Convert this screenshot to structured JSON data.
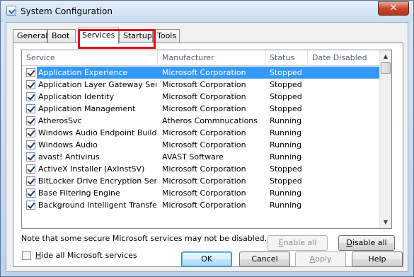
{
  "window": {
    "title": "System Configuration",
    "close_glyph": "✕"
  },
  "tabs": [
    {
      "label": "General"
    },
    {
      "label": "Boot"
    },
    {
      "label": "Services",
      "active": true
    },
    {
      "label": "Startup"
    },
    {
      "label": "Tools"
    }
  ],
  "services_list": {
    "columns": [
      "Service",
      "Manufacturer",
      "Status",
      "Date Disabled"
    ],
    "rows": [
      {
        "name": "Application Experience",
        "manufacturer": "Microsoft Corporation",
        "status": "Stopped",
        "checked": true,
        "selected": true
      },
      {
        "name": "Application Layer Gateway Service",
        "manufacturer": "Microsoft Corporation",
        "status": "Stopped",
        "checked": true
      },
      {
        "name": "Application Identity",
        "manufacturer": "Microsoft Corporation",
        "status": "Stopped",
        "checked": true
      },
      {
        "name": "Application Management",
        "manufacturer": "Microsoft Corporation",
        "status": "Stopped",
        "checked": true
      },
      {
        "name": "AtherosSvc",
        "manufacturer": "Atheros Commnucations",
        "status": "Running",
        "checked": true
      },
      {
        "name": "Windows Audio Endpoint Builder",
        "manufacturer": "Microsoft Corporation",
        "status": "Running",
        "checked": true
      },
      {
        "name": "Windows Audio",
        "manufacturer": "Microsoft Corporation",
        "status": "Running",
        "checked": true
      },
      {
        "name": "avast! Antivirus",
        "manufacturer": "AVAST Software",
        "status": "Running",
        "checked": true
      },
      {
        "name": "ActiveX Installer (AxInstSV)",
        "manufacturer": "Microsoft Corporation",
        "status": "Stopped",
        "checked": true
      },
      {
        "name": "BitLocker Drive Encryption Service",
        "manufacturer": "Microsoft Corporation",
        "status": "Stopped",
        "checked": true
      },
      {
        "name": "Base Filtering Engine",
        "manufacturer": "Microsoft Corporation",
        "status": "Running",
        "checked": true
      },
      {
        "name": "Background Intelligent Transfer ...",
        "manufacturer": "Microsoft Corporation",
        "status": "Running",
        "checked": true
      }
    ]
  },
  "note": "Note that some secure Microsoft services may not be disabled.",
  "enable_all": {
    "prefix": "",
    "hotkey": "E",
    "rest": "nable all"
  },
  "disable_all": {
    "prefix": "",
    "hotkey": "D",
    "rest": "isable all"
  },
  "hide_ms": {
    "prefix": "",
    "hotkey": "H",
    "rest": "ide all Microsoft services",
    "checked": false
  },
  "buttons": {
    "ok": "OK",
    "cancel": "Cancel",
    "apply_hotkey": "A",
    "apply_rest": "pply",
    "help": "Help"
  },
  "scroll": {
    "up": "▲",
    "down": "▼"
  }
}
